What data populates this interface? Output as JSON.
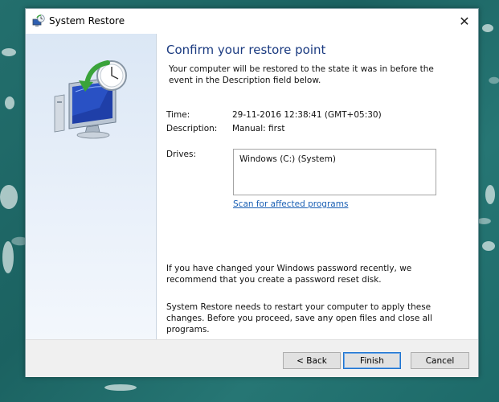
{
  "window": {
    "title": "System Restore",
    "close_glyph": "✕"
  },
  "content": {
    "heading": "Confirm your restore point",
    "intro": "Your computer will be restored to the state it was in before the event in the Description field below.",
    "time_label": "Time:",
    "time_value": "29-11-2016 12:38:41 (GMT+05:30)",
    "description_label": "Description:",
    "description_value": "Manual: first",
    "drives_label": "Drives:",
    "drives": [
      "Windows (C:) (System)"
    ],
    "scan_link": "Scan for affected programs",
    "password_note": "If you have changed your Windows password recently, we recommend that you create a password reset disk.",
    "restart_note": "System Restore needs to restart your computer to apply these changes. Before you proceed, save any open files and close all programs."
  },
  "footer": {
    "back_label": "< Back",
    "finish_label": "Finish",
    "cancel_label": "Cancel"
  },
  "icons": {
    "title": "system-restore-icon",
    "sidebar": "computer-restore-clock-icon"
  },
  "colors": {
    "heading": "#1a3a80",
    "link": "#1a5fb4",
    "sidebar_top": "#dbe7f5",
    "desktop": "#1d6f6e"
  }
}
